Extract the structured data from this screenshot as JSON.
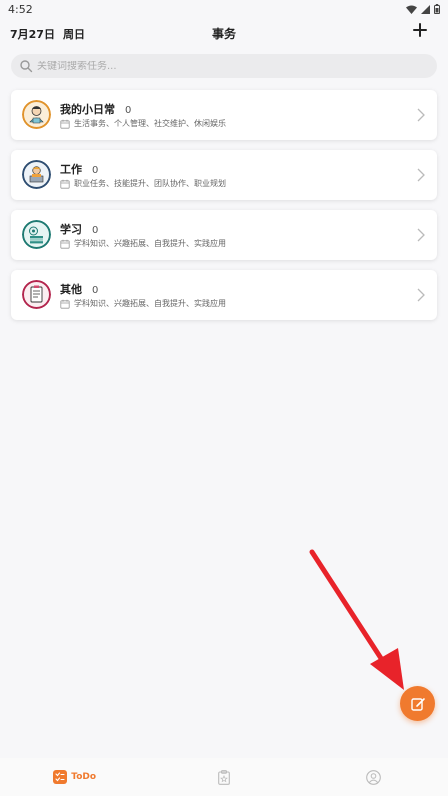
{
  "status_bar": {
    "time": "4:52"
  },
  "header": {
    "date": "7月27日",
    "weekday": "周日",
    "title": "事务"
  },
  "search": {
    "placeholder": "关键词搜索任务..."
  },
  "categories": [
    {
      "name": "我的小日常",
      "count": "0",
      "tags": "生活事务、个人管理、社交维护、休闲娱乐"
    },
    {
      "name": "工作",
      "count": "0",
      "tags": "职业任务、技能提升、团队协作、职业规划"
    },
    {
      "name": "学习",
      "count": "0",
      "tags": "学科知识、兴趣拓展、自我提升、实践应用"
    },
    {
      "name": "其他",
      "count": "0",
      "tags": "学科知识、兴趣拓展、自我提升、实践应用"
    }
  ],
  "bottom_nav": {
    "todo_label": "ToDo"
  },
  "colors": {
    "accent": "#f07a2e",
    "annotation": "#e8232a"
  }
}
